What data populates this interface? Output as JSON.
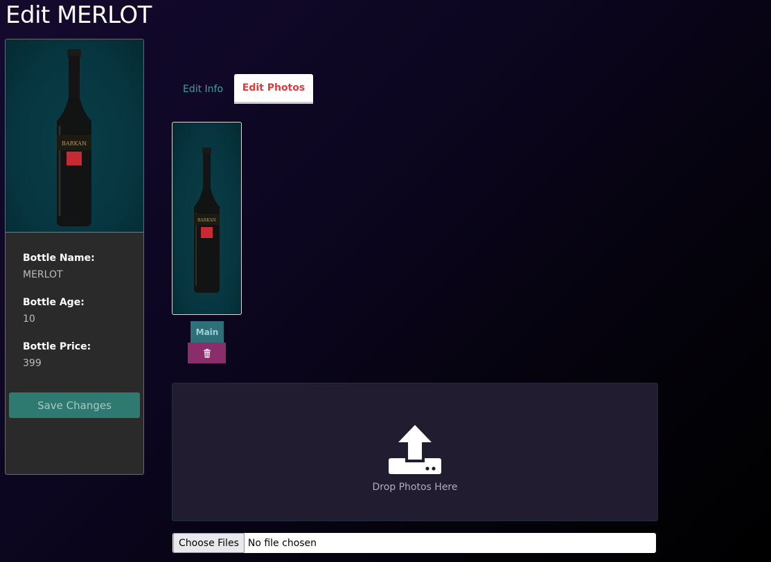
{
  "page": {
    "title": "Edit MERLOT"
  },
  "card": {
    "fields": [
      {
        "label": "Bottle Name:",
        "value": "MERLOT"
      },
      {
        "label": "Bottle Age:",
        "value": "10"
      },
      {
        "label": "Bottle Price:",
        "value": "399"
      }
    ],
    "save_label": "Save Changes"
  },
  "tabs": [
    {
      "label": "Edit Info",
      "active": false
    },
    {
      "label": "Edit Photos",
      "active": true
    }
  ],
  "photos": {
    "main_label": "Main",
    "delete_icon": "trash-icon"
  },
  "dropzone": {
    "text": "Drop Photos Here",
    "icon": "upload-icon"
  },
  "file_input": {
    "button_label": "Choose Files",
    "status": "No file chosen"
  },
  "colors": {
    "accent_teal": "#2f7a70",
    "tab_active_text": "#e03a3a",
    "delete_bg": "#8b2c6b",
    "photo_bg": "#073640"
  }
}
